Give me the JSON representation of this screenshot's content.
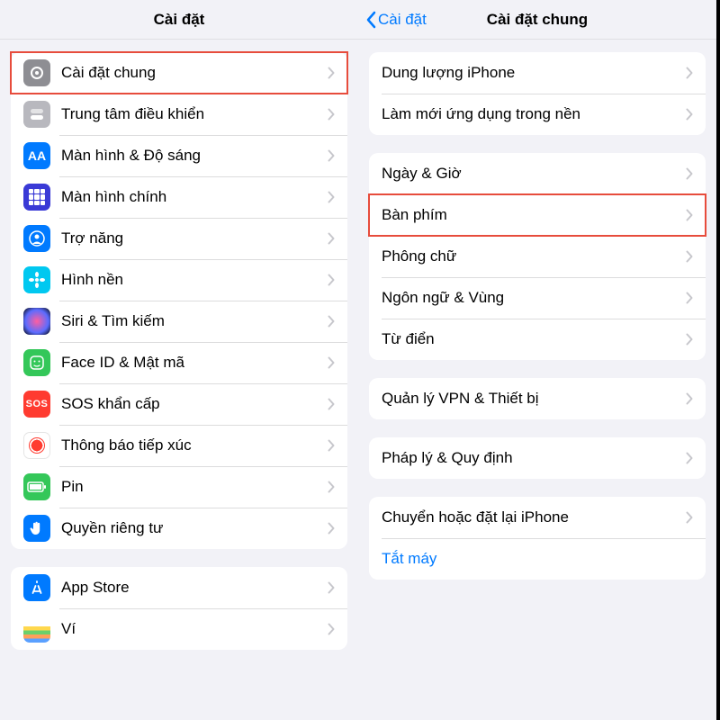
{
  "left": {
    "title": "Cài đặt",
    "group1": [
      {
        "label": "Cài đặt chung",
        "icon": "gear-icon",
        "bg": "bg-gray",
        "glyph": "gear"
      },
      {
        "label": "Trung tâm điều khiển",
        "icon": "control-center-icon",
        "bg": "bg-ltgray",
        "glyph": "toggles"
      },
      {
        "label": "Màn hình & Độ sáng",
        "icon": "display-icon",
        "bg": "bg-blue",
        "glyph": "aa"
      },
      {
        "label": "Màn hình chính",
        "icon": "home-screen-icon",
        "bg": "bg-indigo",
        "glyph": "grid"
      },
      {
        "label": "Trợ năng",
        "icon": "accessibility-icon",
        "bg": "bg-blue",
        "glyph": "person"
      },
      {
        "label": "Hình nền",
        "icon": "wallpaper-icon",
        "bg": "bg-cyan",
        "glyph": "flower"
      },
      {
        "label": "Siri & Tìm kiếm",
        "icon": "siri-icon",
        "bg": "siri",
        "glyph": ""
      },
      {
        "label": "Face ID & Mật mã",
        "icon": "faceid-icon",
        "bg": "bg-green",
        "glyph": "face"
      },
      {
        "label": "SOS khẩn cấp",
        "icon": "sos-icon",
        "bg": "bg-red",
        "glyph": "sos"
      },
      {
        "label": "Thông báo tiếp xúc",
        "icon": "exposure-icon",
        "bg": "bg-white",
        "glyph": "covid"
      },
      {
        "label": "Pin",
        "icon": "battery-icon",
        "bg": "bg-green",
        "glyph": "battery"
      },
      {
        "label": "Quyền riêng tư",
        "icon": "privacy-icon",
        "bg": "bg-blue",
        "glyph": "hand"
      }
    ],
    "group2": [
      {
        "label": "App Store",
        "icon": "appstore-icon",
        "bg": "bg-blue",
        "glyph": "appstore"
      },
      {
        "label": "Ví",
        "icon": "wallet-icon",
        "bg": "wallet",
        "glyph": ""
      }
    ]
  },
  "right": {
    "back": "Cài đặt",
    "title": "Cài đặt chung",
    "group1": [
      {
        "label": "Dung lượng iPhone"
      },
      {
        "label": "Làm mới ứng dụng trong nền"
      }
    ],
    "group2": [
      {
        "label": "Ngày & Giờ"
      },
      {
        "label": "Bàn phím"
      },
      {
        "label": "Phông chữ"
      },
      {
        "label": "Ngôn ngữ & Vùng"
      },
      {
        "label": "Từ điển"
      }
    ],
    "group3": [
      {
        "label": "Quản lý VPN & Thiết bị"
      }
    ],
    "group4": [
      {
        "label": "Pháp lý & Quy định"
      }
    ],
    "group5": [
      {
        "label": "Chuyển hoặc đặt lại iPhone"
      },
      {
        "label": "Tắt máy",
        "blue": true,
        "noChevron": true
      }
    ]
  },
  "highlights": {
    "left_row": 0,
    "right_row": "group2.1"
  }
}
